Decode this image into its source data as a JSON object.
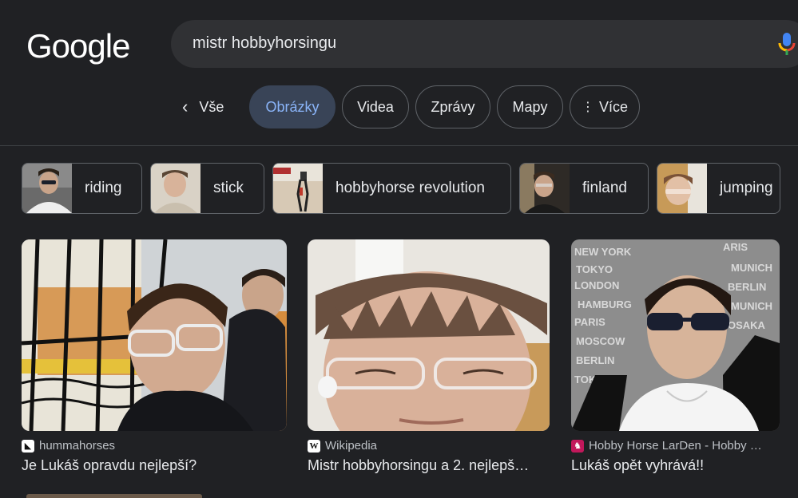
{
  "logo": "Google",
  "search": {
    "query": "mistr hobbyhorsingu",
    "mic_icon": "microphone-icon"
  },
  "back_label": "Vše",
  "tabs": [
    {
      "label": "Obrázky",
      "active": true
    },
    {
      "label": "Videa"
    },
    {
      "label": "Zprávy"
    },
    {
      "label": "Mapy"
    },
    {
      "label": "Více",
      "icon": "more-vert-icon"
    }
  ],
  "chips": [
    {
      "label": "riding"
    },
    {
      "label": "stick"
    },
    {
      "label": "hobbyhorse revolution"
    },
    {
      "label": "finland"
    },
    {
      "label": "jumping"
    }
  ],
  "results": [
    {
      "source": "hummahorses",
      "title": "Je Lukáš opravdu nejlepší?"
    },
    {
      "source": "Wikipedia",
      "title": "Mistr hobbyhorsingu a 2. nejlepš…"
    },
    {
      "source": "Hobby Horse LarDen - Hobby …",
      "title": "Lukáš opět vyhrává!!"
    }
  ],
  "colors": {
    "background": "#202124",
    "active_tab_bg": "#394457",
    "active_tab_text": "#8ab4f8"
  }
}
